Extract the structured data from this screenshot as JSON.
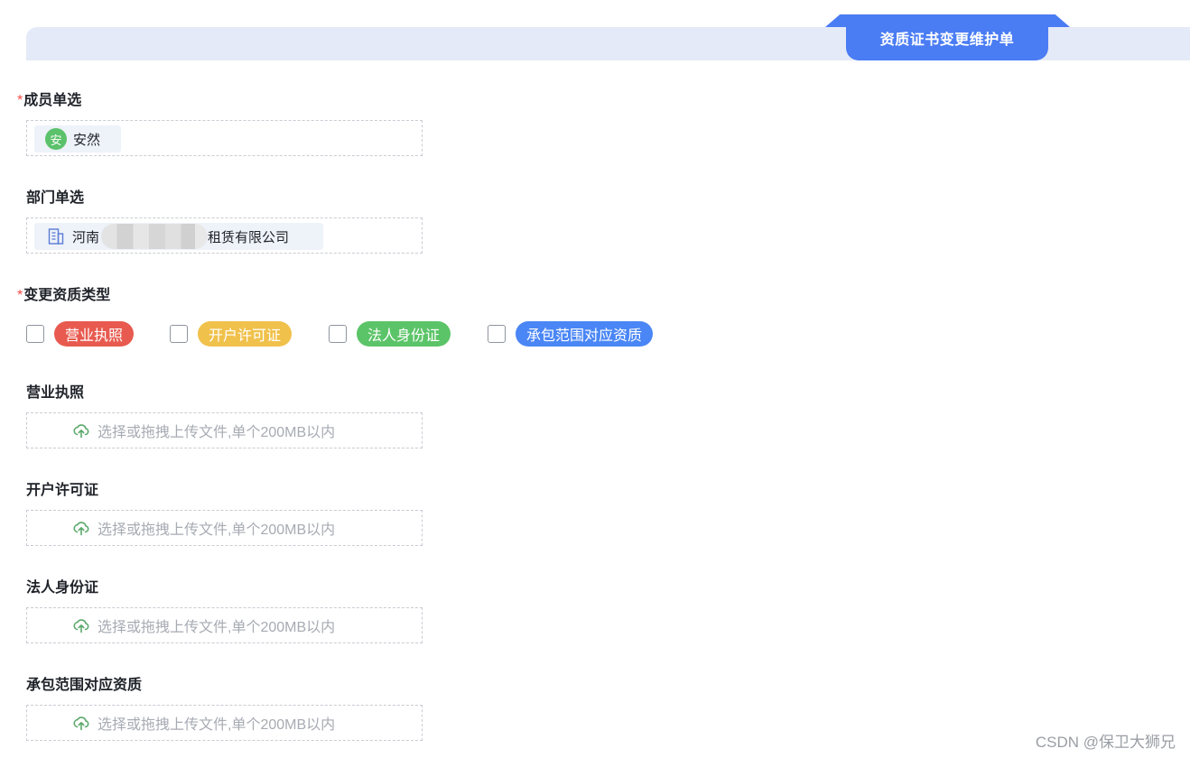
{
  "header": {
    "title": "资质证书变更维护单"
  },
  "member": {
    "label": "成员单选",
    "required": "*",
    "avatar_char": "安",
    "name": "安然"
  },
  "department": {
    "label": "部门单选",
    "name_start": "河南",
    "name_end": "租赁有限公司"
  },
  "qualification_type": {
    "label": "变更资质类型",
    "required": "*",
    "options": [
      {
        "label": "营业执照",
        "color": "#e85a4f"
      },
      {
        "label": "开户许可证",
        "color": "#f0c14b"
      },
      {
        "label": "法人身份证",
        "color": "#5cc468"
      },
      {
        "label": "承包范围对应资质",
        "color": "#4a86f5"
      }
    ]
  },
  "uploads": [
    {
      "label": "营业执照",
      "hint": "选择或拖拽上传文件,单个200MB以内"
    },
    {
      "label": "开户许可证",
      "hint": "选择或拖拽上传文件,单个200MB以内"
    },
    {
      "label": "法人身份证",
      "hint": "选择或拖拽上传文件,单个200MB以内"
    },
    {
      "label": "承包范围对应资质",
      "hint": "选择或拖拽上传文件,单个200MB以内"
    }
  ],
  "watermark": "CSDN @保卫大狮兄",
  "icons": {
    "upload": "cloud-upload-icon",
    "department": "building-icon",
    "checkbox": "checkbox-empty"
  }
}
